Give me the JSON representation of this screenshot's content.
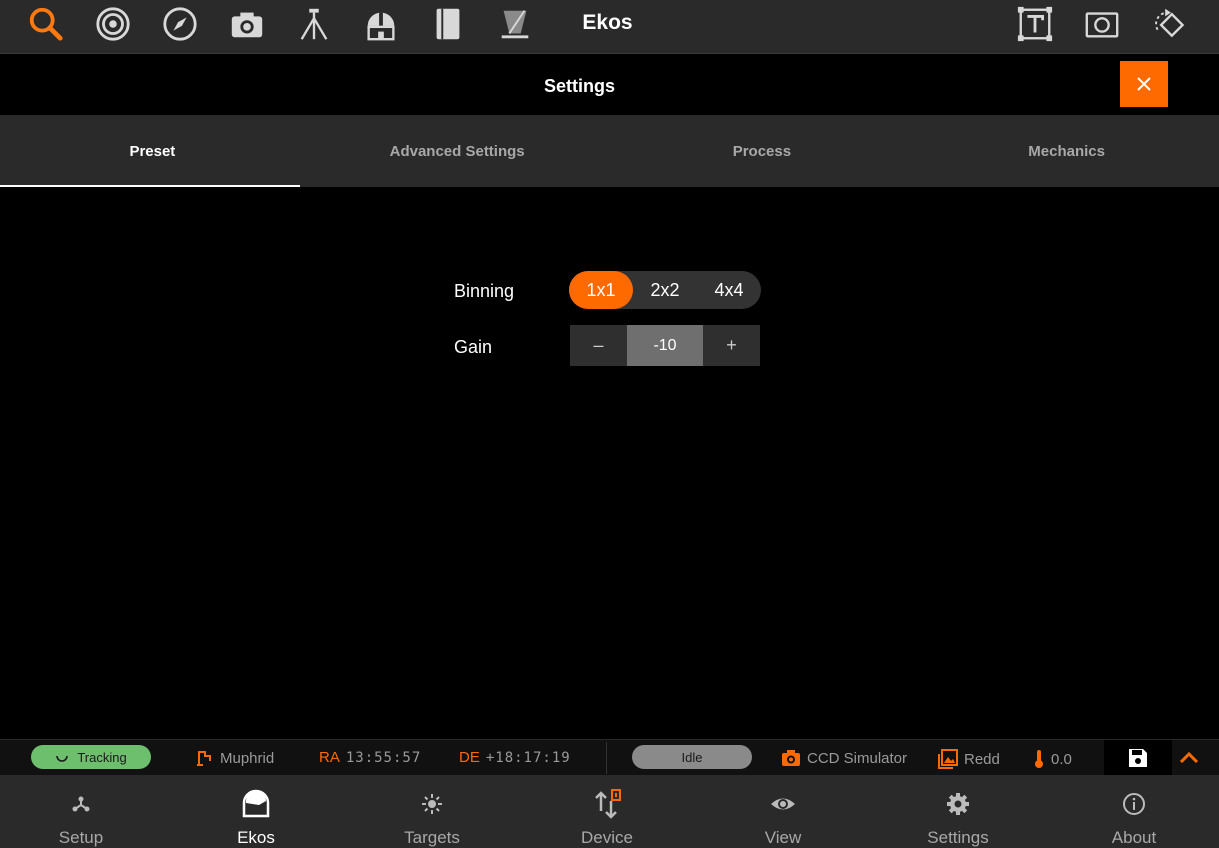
{
  "toolbar": {
    "title": "Ekos",
    "tools": [
      "search-icon",
      "target-icon",
      "compass-icon",
      "camera-icon",
      "tripod-icon",
      "observatory-icon",
      "notebook-icon",
      "filter-icon"
    ],
    "right_tools": [
      "text-frame-icon",
      "screenshot-icon",
      "rotate-icon"
    ]
  },
  "settings": {
    "title": "Settings",
    "close_icon": "close-icon"
  },
  "tabs": [
    {
      "label": "Preset",
      "active": true
    },
    {
      "label": "Advanced Settings",
      "active": false
    },
    {
      "label": "Process",
      "active": false
    },
    {
      "label": "Mechanics",
      "active": false
    }
  ],
  "preset": {
    "binning_label": "Binning",
    "binning_options": [
      "1x1",
      "2x2",
      "4x4"
    ],
    "binning_selected": "1x1",
    "gain_label": "Gain",
    "gain_minus": "–",
    "gain_value": "-10",
    "gain_plus": "+"
  },
  "status": {
    "tracking": "Tracking",
    "target": "Muphrid",
    "ra_label": "RA",
    "ra_value": "13:55:57",
    "de_label": "DE",
    "de_value": "+18:17:19",
    "state": "Idle",
    "camera": "CCD Simulator",
    "image": "Redd",
    "temperature": "0.0"
  },
  "nav": [
    {
      "label": "Setup",
      "active": false
    },
    {
      "label": "Ekos",
      "active": true
    },
    {
      "label": "Targets",
      "active": false
    },
    {
      "label": "Device",
      "active": false
    },
    {
      "label": "View",
      "active": false
    },
    {
      "label": "Settings",
      "active": false
    },
    {
      "label": "About",
      "active": false
    }
  ],
  "colors": {
    "accent": "#ff6a00",
    "tracking_green": "#6dbf6d",
    "idle_gray": "#8a8a8a"
  }
}
